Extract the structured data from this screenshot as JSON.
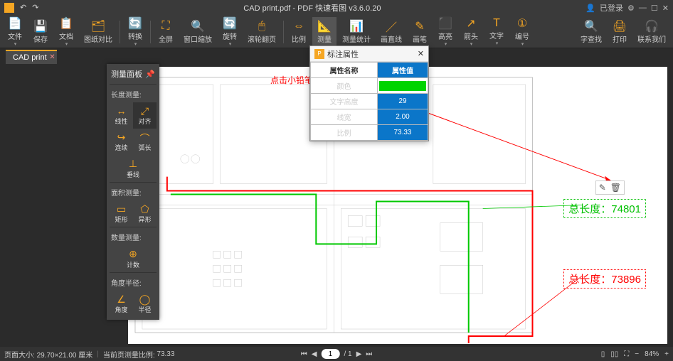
{
  "title": "CAD print.pdf - PDF 快速看图 v3.6.0.20",
  "login_label": "已登录",
  "tab": {
    "name": "CAD print"
  },
  "toolbar": {
    "file": "文件",
    "save": "保存",
    "doc": "文档",
    "compare": "图纸对比",
    "convert": "转换",
    "fullscreen": "全屏",
    "window_zoom": "窗口缩放",
    "rotate": "旋转",
    "wheel_page": "滚轮翻页",
    "scale": "比例",
    "measure": "测量",
    "measure_stat": "测量统计",
    "line": "画直线",
    "brush": "画笔",
    "highlight": "高亮",
    "arrow": "箭头",
    "text": "文字",
    "number": "编号",
    "lookup": "字查找",
    "print": "打印",
    "contact": "联系我们"
  },
  "measure_panel": {
    "title": "测量面板",
    "section_length": "长度测量:",
    "linear": "线性",
    "align": "对齐",
    "continuous": "连续",
    "arc": "弧长",
    "vertical": "垂线",
    "section_area": "面积测量:",
    "rect": "矩形",
    "poly": "异形",
    "section_count": "数量测量:",
    "count": "计数",
    "section_angle": "角度半径:",
    "angle": "角度",
    "radius": "半径"
  },
  "prop_panel": {
    "title": "标注属性",
    "h_name": "属性名称",
    "h_value": "属性值",
    "rows": [
      {
        "name": "颜色"
      },
      {
        "name": "文字高度",
        "value": "29"
      },
      {
        "name": "线宽",
        "value": "2.00"
      },
      {
        "name": "比例",
        "value": "73.33"
      }
    ]
  },
  "annotation_hint": "点击小铅笔还可以对标注进行编辑",
  "totals": {
    "green_label": "总长度：74801",
    "red_label": "总长度：73896"
  },
  "statusbar": {
    "page_size_label": "页面大小:",
    "page_size": "29.70×21.00 厘米",
    "scale_label": "当前页测量比例:",
    "scale": "73.33",
    "page_current": "1",
    "page_total": "/ 1",
    "zoom": "84%"
  }
}
